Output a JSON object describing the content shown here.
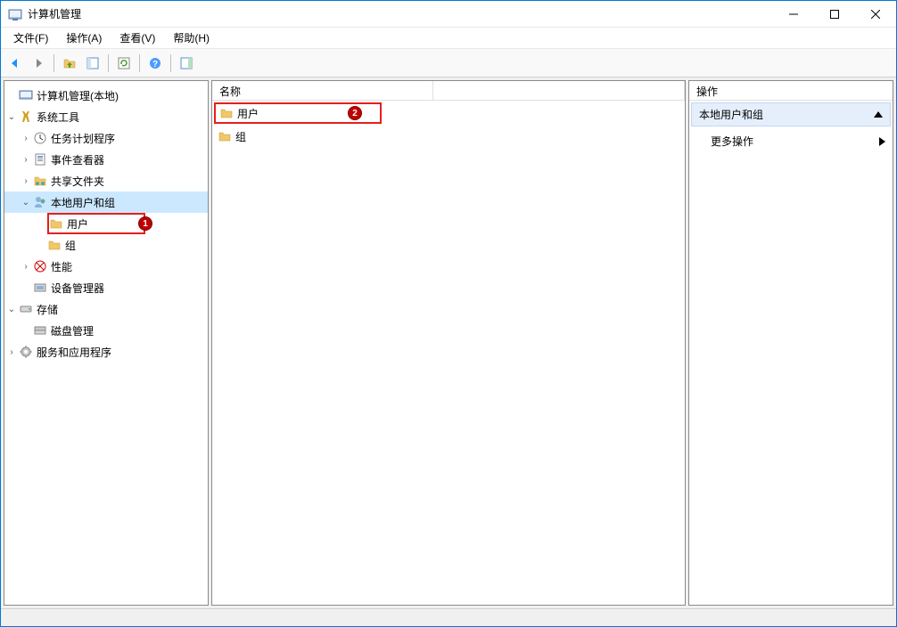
{
  "window": {
    "title": "计算机管理"
  },
  "menu": {
    "file": "文件(F)",
    "action": "操作(A)",
    "view": "查看(V)",
    "help": "帮助(H)"
  },
  "tree": {
    "root": "计算机管理(本地)",
    "system_tools": "系统工具",
    "task_scheduler": "任务计划程序",
    "event_viewer": "事件查看器",
    "shared_folders": "共享文件夹",
    "local_users_groups": "本地用户和组",
    "users": "用户",
    "groups": "组",
    "performance": "性能",
    "device_manager": "设备管理器",
    "storage": "存储",
    "disk_management": "磁盘管理",
    "services_apps": "服务和应用程序"
  },
  "list": {
    "header_name": "名称",
    "users": "用户",
    "groups": "组"
  },
  "actions": {
    "header": "操作",
    "section_title": "本地用户和组",
    "more_actions": "更多操作"
  },
  "annotations": {
    "badge1": "1",
    "badge2": "2"
  }
}
